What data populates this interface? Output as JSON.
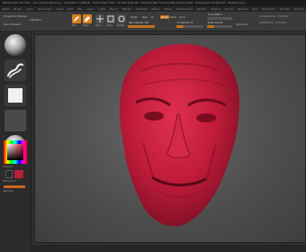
{
  "window": {
    "title": "ZBrush 4R7 P3 (x64) - Document [Memory] - Free Mem 3.065GB - Active Mem 878 - Scratch Disk 48 - RTime:0.000 Timer:0.000 ATime:0.000 - PolyCount:376,822 KP - MeshCount:1"
  },
  "menu": {
    "items": [
      "Alpha",
      "Brush",
      "Color",
      "Document",
      "Draw",
      "Edit",
      "File",
      "Layer",
      "Light",
      "Macro",
      "Marker",
      "Material",
      "Movie",
      "Picker",
      "Preferences",
      "Render",
      "Stencil",
      "Stroke",
      "Texture",
      "Tool",
      "Transform",
      "Zplugin",
      "Zscript"
    ]
  },
  "toolbar": {
    "projection_label": "Projection Master",
    "lightbox_label": "LightBox",
    "quick_sketch_label": "Quick Sketch",
    "edit_label": "Edit",
    "draw_label": "Draw",
    "move_label": "Move",
    "scale_label": "Scale",
    "rotate_label": "Rotate",
    "mrgb_label": "Mrgb",
    "rgb_label": "Rgb",
    "m_label": "M",
    "zadd_label": "Zadd",
    "zsub_label": "Zsub",
    "zcut_label": "Zcut",
    "rgb_intensity": "Rgb Intensity 100",
    "rgb_intensity_value": 1.0,
    "z_intensity": "Z Intensity 25",
    "z_intensity_value": 0.25,
    "focal_shift": "Focal Shift 0",
    "draw_size": "Draw Size 64",
    "active_points": "ActivePoints: 376,822",
    "total_points": "TotalPoints: 376,822",
    "dynamic_label": "Dynamic"
  },
  "left_tray": {
    "brush_icon": "standard-brush-icon",
    "stroke_icon": "freehand-stroke-icon",
    "alpha_icon": "alpha-square-icon",
    "texture_icon": "texture-off-icon",
    "material_icon": "basic-material-icon",
    "gradient_label": "Gradient",
    "switch_color_label": "SwitchColor",
    "alternate_label": "Alternate"
  },
  "colors": {
    "accent": "#d88020",
    "main_color": "#b8203a",
    "model_color": "#c01c3a"
  },
  "status": {
    "hint": ""
  }
}
